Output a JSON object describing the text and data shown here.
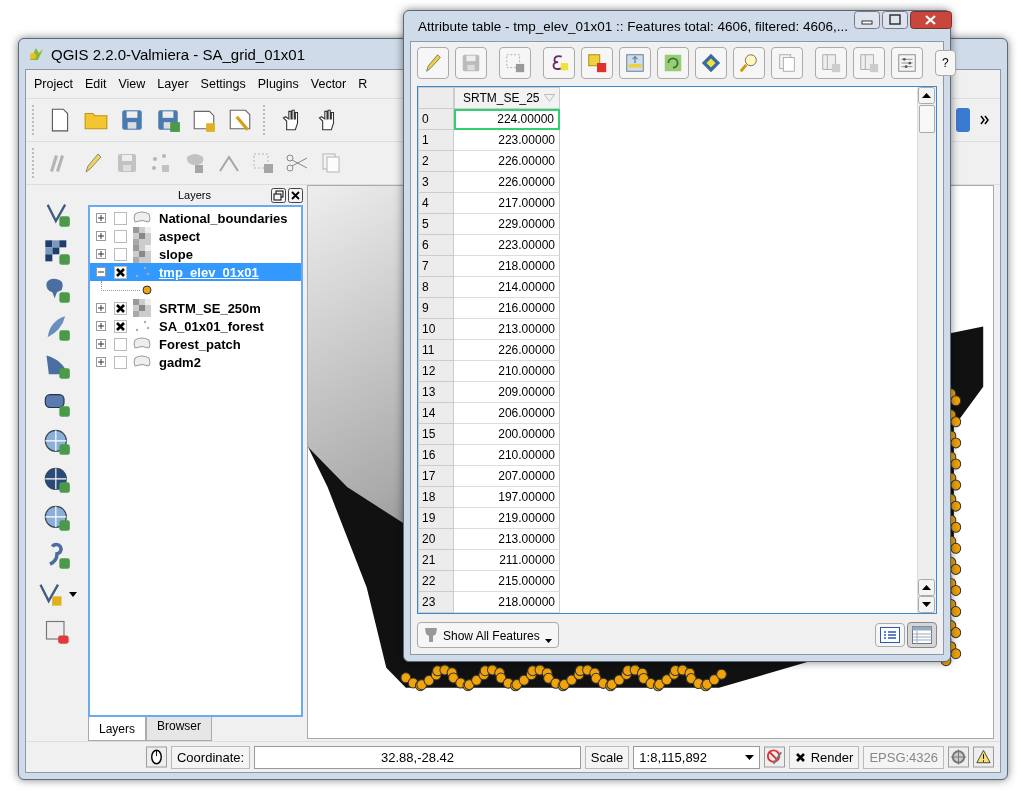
{
  "main_window": {
    "title": "QGIS 2.2.0-Valmiera - SA_grid_01x01"
  },
  "menu_bar": [
    "Project",
    "Edit",
    "View",
    "Layer",
    "Settings",
    "Plugins",
    "Vector",
    "R"
  ],
  "layers_panel": {
    "title": "Layers",
    "layers": [
      {
        "name": "National_boundaries",
        "kind": "polygon",
        "checked": false,
        "selected": false,
        "expanded": false
      },
      {
        "name": "aspect",
        "kind": "raster",
        "checked": false,
        "selected": false,
        "expanded": false
      },
      {
        "name": "slope",
        "kind": "raster",
        "checked": false,
        "selected": false,
        "expanded": false
      },
      {
        "name": "tmp_elev_01x01",
        "kind": "point",
        "checked": true,
        "selected": true,
        "expanded": true
      },
      {
        "name": "SRTM_SE_250m",
        "kind": "raster",
        "checked": true,
        "selected": false,
        "expanded": false
      },
      {
        "name": "SA_01x01_forest",
        "kind": "point",
        "checked": true,
        "selected": false,
        "expanded": false
      },
      {
        "name": "Forest_patch",
        "kind": "polygon",
        "checked": false,
        "selected": false,
        "expanded": false
      },
      {
        "name": "gadm2",
        "kind": "polygon",
        "checked": false,
        "selected": false,
        "expanded": false
      }
    ],
    "tabs": [
      {
        "label": "Layers",
        "selected": true
      },
      {
        "label": "Browser",
        "selected": false
      }
    ]
  },
  "status_bar": {
    "coordinate_label": "Coordinate:",
    "coordinate": "32.88,-28.42",
    "scale_label": "Scale",
    "scale": "1:8,115,892",
    "render": {
      "label": "Render",
      "checked": true
    },
    "crs": "EPSG:4326"
  },
  "attribute_table": {
    "title": "Attribute table - tmp_elev_01x01 :: Features total: 4606, filtered: 4606,...",
    "help_button": "?",
    "columns": [
      "SRTM_SE_25"
    ],
    "rows": [
      {
        "id": "0",
        "value": "224.00000",
        "selected": true
      },
      {
        "id": "1",
        "value": "223.00000",
        "selected": false
      },
      {
        "id": "2",
        "value": "226.00000",
        "selected": false
      },
      {
        "id": "3",
        "value": "226.00000",
        "selected": false
      },
      {
        "id": "4",
        "value": "217.00000",
        "selected": false
      },
      {
        "id": "5",
        "value": "229.00000",
        "selected": false
      },
      {
        "id": "6",
        "value": "223.00000",
        "selected": false
      },
      {
        "id": "7",
        "value": "218.00000",
        "selected": false
      },
      {
        "id": "8",
        "value": "214.00000",
        "selected": false
      },
      {
        "id": "9",
        "value": "216.00000",
        "selected": false
      },
      {
        "id": "10",
        "value": "213.00000",
        "selected": false
      },
      {
        "id": "11",
        "value": "226.00000",
        "selected": false
      },
      {
        "id": "12",
        "value": "210.00000",
        "selected": false
      },
      {
        "id": "13",
        "value": "209.00000",
        "selected": false
      },
      {
        "id": "14",
        "value": "206.00000",
        "selected": false
      },
      {
        "id": "15",
        "value": "200.00000",
        "selected": false
      },
      {
        "id": "16",
        "value": "210.00000",
        "selected": false
      },
      {
        "id": "17",
        "value": "207.00000",
        "selected": false
      },
      {
        "id": "18",
        "value": "197.00000",
        "selected": false
      },
      {
        "id": "19",
        "value": "219.00000",
        "selected": false
      },
      {
        "id": "20",
        "value": "213.00000",
        "selected": false
      },
      {
        "id": "21",
        "value": "211.00000",
        "selected": false
      },
      {
        "id": "22",
        "value": "215.00000",
        "selected": false
      },
      {
        "id": "23",
        "value": "218.00000",
        "selected": false
      }
    ],
    "show_features": "Show All Features",
    "views": [
      {
        "kind": "form",
        "selected": false
      },
      {
        "kind": "table",
        "selected": true
      }
    ]
  }
}
